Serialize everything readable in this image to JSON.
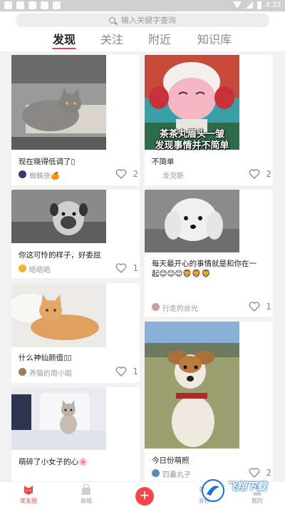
{
  "status_bar": {
    "time": "4:33"
  },
  "search": {
    "placeholder": "输入关键字查询"
  },
  "tabs": [
    {
      "label": "发现",
      "active": true
    },
    {
      "label": "关注",
      "active": false
    },
    {
      "label": "附近",
      "active": false
    },
    {
      "label": "知识库",
      "active": false
    }
  ],
  "accent_color": "#e14b4b",
  "feed": {
    "left": [
      {
        "title": "现在晓得低调了▯",
        "user": "蜘蛛侠🍊",
        "likes": "2",
        "image": "grey cat lying on desk"
      },
      {
        "title": "你这可怜的样子，好委屈",
        "user": "晤晤晤",
        "likes": "1",
        "image": "pug puppy black and white"
      },
      {
        "title": "什么神仙颜值▯▯",
        "user": "养猫的周小姐",
        "likes": "1",
        "image": "orange tabby cat on bed"
      },
      {
        "title": "萌碎了小女子的心🌸",
        "user": "",
        "likes": "",
        "image": "small tabby kitten on pillow"
      }
    ],
    "right": [
      {
        "title": "不简单",
        "user": "龙克斯",
        "likes": "2",
        "image": "cartoon sheep meme",
        "caption_line1": "茶茶丸眉头一皱",
        "caption_line2": "发现事情并不简单"
      },
      {
        "title_line1": "每天最开心的事情就是和你在一",
        "title_line2": "起😊😊😊🦁🦁🦁",
        "user": "行走的丝光",
        "likes": "1",
        "image": "white fluffy puppy black and white"
      },
      {
        "title": "今日份萌照",
        "user": "四囊丸子",
        "likes": "2",
        "image": "brown and white dog on grass"
      }
    ]
  },
  "bottom_nav": [
    {
      "label": "宠友圈",
      "active": true
    },
    {
      "label": "商城",
      "active": false
    },
    {
      "label": "",
      "icon": "add-icon"
    },
    {
      "label": "消息",
      "active": false
    },
    {
      "label": "我的",
      "active": false
    }
  ],
  "watermark": {
    "text": "飞翔下载"
  },
  "icons": [
    "search-icon",
    "heart-icon",
    "add-icon",
    "cat-face-icon",
    "shop-bag-icon",
    "wifi-icon",
    "signal-icon",
    "battery-icon"
  ]
}
